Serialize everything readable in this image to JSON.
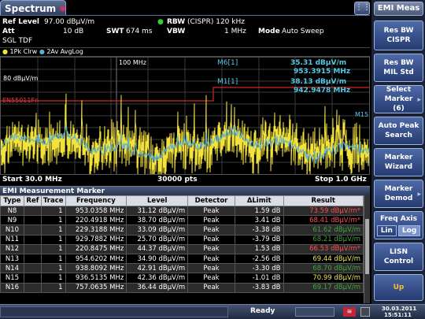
{
  "tab": {
    "title": "Spectrum"
  },
  "header": {
    "ref_level_label": "Ref Level",
    "ref_level_value": "97.00 dBµV/m",
    "att_label": "Att",
    "att_value": "10 dB",
    "swt_label": "SWT",
    "swt_value": "674 ms",
    "sgl": "SGL TDF",
    "rbw_label": "RBW",
    "rbw_value": "(CISPR)  120 kHz",
    "vbw_label": "VBW",
    "vbw_value": "1 MHz",
    "mode_label": "Mode",
    "mode_value": "Auto Sweep"
  },
  "traces": {
    "t1": "1Pk Clrw",
    "t2": "2Av AvgLog"
  },
  "plot": {
    "y_ref_label": "80 dBµV/m",
    "x_marker_label": "100 MHz",
    "limit_label": "EN55011Fn",
    "m6_label": "M6[1]",
    "m6_level": "35.31 dBµV/m",
    "m6_freq": "953.3915 MHz",
    "m1_label": "M1[1]",
    "m1_level": "38.13 dBµV/m",
    "m1_freq": "942.9478 MHz",
    "m15_label": "M15",
    "start": "Start 30.0 MHz",
    "points": "30000 pts",
    "stop": "Stop 1.0 GHz"
  },
  "table": {
    "title": "EMI Measurement Marker",
    "headers": [
      "Type",
      "Ref",
      "Trace",
      "Frequency",
      "Level",
      "Detector",
      "ΔLimit",
      "Result"
    ],
    "rows": [
      [
        "N8",
        "",
        "1",
        "953.0358 MHz",
        "31.12 dBµV/m",
        "Peak",
        "1.59 dB",
        "73.59 dBµV/m*"
      ],
      [
        "N9",
        "",
        "1",
        "220.4918 MHz",
        "38.70 dBµV/m",
        "Peak",
        "3.41 dB",
        "68.41 dBµV/m*"
      ],
      [
        "N10",
        "",
        "1",
        "229.3188 MHz",
        "33.09 dBµV/m",
        "Peak",
        "-3.38 dB",
        "61.62 dBµV/m"
      ],
      [
        "N11",
        "",
        "1",
        "929.7882 MHz",
        "25.70 dBµV/m",
        "Peak",
        "-3.79 dB",
        "68.21 dBµV/m"
      ],
      [
        "N12",
        "",
        "1",
        "220.8475 MHz",
        "44.37 dBµV/m",
        "Peak",
        "1.53 dB",
        "66.53 dBµV/m*"
      ],
      [
        "N13",
        "",
        "1",
        "954.6202 MHz",
        "34.90 dBµV/m",
        "Peak",
        "-2.56 dB",
        "69.44 dBµV/m"
      ],
      [
        "N14",
        "",
        "1",
        "938.8092 MHz",
        "42.91 dBµV/m",
        "Peak",
        "-3.30 dB",
        "68.70 dBµV/m"
      ],
      [
        "N15",
        "",
        "1",
        "936.5135 MHz",
        "42.36 dBµV/m",
        "Peak",
        "-1.01 dB",
        "70.99 dBµV/m"
      ],
      [
        "N16",
        "",
        "1",
        "757.0635 MHz",
        "36.44 dBµV/m",
        "Peak",
        "-3.83 dB",
        "69.17 dBµV/m"
      ]
    ],
    "result_colors": [
      "#ff4d4d",
      "#ff4d4d",
      "#3fa33f",
      "#3fa33f",
      "#ff4d4d",
      "#e8e85a",
      "#3fa33f",
      "#e8e85a",
      "#3fa33f"
    ]
  },
  "status": {
    "ready": "Ready",
    "date": "30.03.2011",
    "time": "15:51:11"
  },
  "softkeys": {
    "title": "EMI Meas",
    "res_bw_cispr": [
      "Res BW",
      "CISPR"
    ],
    "res_bw_mil": [
      "Res BW",
      "MIL Std"
    ],
    "select_marker": [
      "Select",
      "Marker",
      "(6)"
    ],
    "auto_peak": [
      "Auto Peak",
      "Search"
    ],
    "marker_wizard": [
      "Marker",
      "Wizard"
    ],
    "marker_demod": [
      "Marker",
      "Demod"
    ],
    "freq_axis": "Freq Axis",
    "lin": "Lin",
    "log": "Log",
    "lisn": [
      "LISN",
      "Control"
    ],
    "up": "Up"
  },
  "colors": {
    "trace1": "#f2e23a",
    "trace2": "#5bb0d0",
    "limit": "#cc2a2a",
    "marker_text": "#55c8e6"
  }
}
